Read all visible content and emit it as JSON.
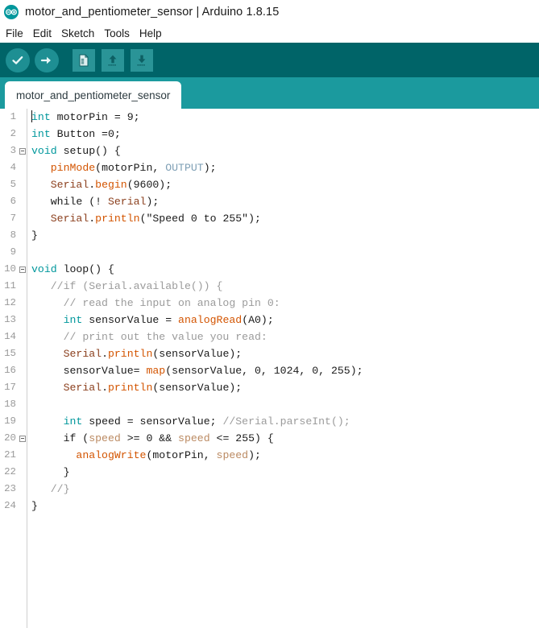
{
  "window": {
    "title": "motor_and_pentiometer_sensor | Arduino 1.8.15",
    "logo_icon": "arduino-infinity-logo"
  },
  "menubar": {
    "items": [
      {
        "label": "File"
      },
      {
        "label": "Edit"
      },
      {
        "label": "Sketch"
      },
      {
        "label": "Tools"
      },
      {
        "label": "Help"
      }
    ]
  },
  "toolbar": {
    "background": "#006468",
    "buttons": [
      {
        "name": "verify-button",
        "icon": "checkmark-icon",
        "shape": "round"
      },
      {
        "name": "upload-button",
        "icon": "arrow-right-icon",
        "shape": "round"
      },
      {
        "name": "new-button",
        "icon": "new-file-icon",
        "shape": "square"
      },
      {
        "name": "open-button",
        "icon": "arrow-up-icon",
        "shape": "square"
      },
      {
        "name": "save-button",
        "icon": "arrow-down-icon",
        "shape": "square"
      }
    ]
  },
  "tabs": {
    "background": "#1b9a9e",
    "active_tab": "motor_and_pentiometer_sensor"
  },
  "editor": {
    "accent_color": "#00979c",
    "lines": [
      {
        "n": "1",
        "fold": false,
        "tokens": [
          {
            "t": "caret",
            "c": "caret"
          },
          {
            "t": "int",
            "c": "kw"
          },
          {
            "t": " motorPin = 9;",
            "c": "plain"
          }
        ]
      },
      {
        "n": "2",
        "fold": false,
        "tokens": [
          {
            "t": "int",
            "c": "kw"
          },
          {
            "t": " Button =0;",
            "c": "plain"
          }
        ]
      },
      {
        "n": "3",
        "fold": true,
        "tokens": [
          {
            "t": "void",
            "c": "kw"
          },
          {
            "t": " setup() {",
            "c": "plain"
          }
        ]
      },
      {
        "n": "4",
        "fold": false,
        "tokens": [
          {
            "t": "   ",
            "c": "plain"
          },
          {
            "t": "pinMode",
            "c": "fn"
          },
          {
            "t": "(motorPin, ",
            "c": "plain"
          },
          {
            "t": "OUTPUT",
            "c": "cnst"
          },
          {
            "t": ");",
            "c": "plain"
          }
        ]
      },
      {
        "n": "5",
        "fold": false,
        "tokens": [
          {
            "t": "   ",
            "c": "plain"
          },
          {
            "t": "Serial",
            "c": "lib"
          },
          {
            "t": ".",
            "c": "plain"
          },
          {
            "t": "begin",
            "c": "fn"
          },
          {
            "t": "(9600);",
            "c": "plain"
          }
        ]
      },
      {
        "n": "6",
        "fold": false,
        "tokens": [
          {
            "t": "   while (! ",
            "c": "plain"
          },
          {
            "t": "Serial",
            "c": "lib"
          },
          {
            "t": ");",
            "c": "plain"
          }
        ]
      },
      {
        "n": "7",
        "fold": false,
        "tokens": [
          {
            "t": "   ",
            "c": "plain"
          },
          {
            "t": "Serial",
            "c": "lib"
          },
          {
            "t": ".",
            "c": "plain"
          },
          {
            "t": "println",
            "c": "fn"
          },
          {
            "t": "(\"Speed 0 to 255\");",
            "c": "plain"
          }
        ]
      },
      {
        "n": "8",
        "fold": false,
        "tokens": [
          {
            "t": "}",
            "c": "plain"
          }
        ]
      },
      {
        "n": "9",
        "fold": false,
        "tokens": [
          {
            "t": "",
            "c": "plain"
          }
        ]
      },
      {
        "n": "10",
        "fold": true,
        "tokens": [
          {
            "t": "void",
            "c": "kw"
          },
          {
            "t": " loop() {",
            "c": "plain"
          }
        ]
      },
      {
        "n": "11",
        "fold": false,
        "tokens": [
          {
            "t": "   ",
            "c": "plain"
          },
          {
            "t": "//if (Serial.available()) {",
            "c": "cmt"
          }
        ]
      },
      {
        "n": "12",
        "fold": false,
        "tokens": [
          {
            "t": "     ",
            "c": "plain"
          },
          {
            "t": "// read the input on analog pin 0:",
            "c": "cmt"
          }
        ]
      },
      {
        "n": "13",
        "fold": false,
        "tokens": [
          {
            "t": "     ",
            "c": "plain"
          },
          {
            "t": "int",
            "c": "kw"
          },
          {
            "t": " sensorValue = ",
            "c": "plain"
          },
          {
            "t": "analogRead",
            "c": "fn"
          },
          {
            "t": "(A0);",
            "c": "plain"
          }
        ]
      },
      {
        "n": "14",
        "fold": false,
        "tokens": [
          {
            "t": "     ",
            "c": "plain"
          },
          {
            "t": "// print out the value you read:",
            "c": "cmt"
          }
        ]
      },
      {
        "n": "15",
        "fold": false,
        "tokens": [
          {
            "t": "     ",
            "c": "plain"
          },
          {
            "t": "Serial",
            "c": "lib"
          },
          {
            "t": ".",
            "c": "plain"
          },
          {
            "t": "println",
            "c": "fn"
          },
          {
            "t": "(sensorValue);",
            "c": "plain"
          }
        ]
      },
      {
        "n": "16",
        "fold": false,
        "tokens": [
          {
            "t": "     sensorValue= ",
            "c": "plain"
          },
          {
            "t": "map",
            "c": "fn"
          },
          {
            "t": "(sensorValue, 0, 1024, 0, 255);",
            "c": "plain"
          }
        ]
      },
      {
        "n": "17",
        "fold": false,
        "tokens": [
          {
            "t": "     ",
            "c": "plain"
          },
          {
            "t": "Serial",
            "c": "lib"
          },
          {
            "t": ".",
            "c": "plain"
          },
          {
            "t": "println",
            "c": "fn"
          },
          {
            "t": "(sensorValue);",
            "c": "plain"
          }
        ]
      },
      {
        "n": "18",
        "fold": false,
        "tokens": [
          {
            "t": "",
            "c": "plain"
          }
        ]
      },
      {
        "n": "19",
        "fold": false,
        "tokens": [
          {
            "t": "     ",
            "c": "plain"
          },
          {
            "t": "int",
            "c": "kw"
          },
          {
            "t": " speed = sensorValue; ",
            "c": "plain"
          },
          {
            "t": "//Serial.parseInt();",
            "c": "cmt"
          }
        ]
      },
      {
        "n": "20",
        "fold": true,
        "tokens": [
          {
            "t": "     if (",
            "c": "plain"
          },
          {
            "t": "speed",
            "c": "var"
          },
          {
            "t": " >= 0 && ",
            "c": "plain"
          },
          {
            "t": "speed",
            "c": "var"
          },
          {
            "t": " <= 255) {",
            "c": "plain"
          }
        ]
      },
      {
        "n": "21",
        "fold": false,
        "tokens": [
          {
            "t": "       ",
            "c": "plain"
          },
          {
            "t": "analogWrite",
            "c": "fn"
          },
          {
            "t": "(motorPin, ",
            "c": "plain"
          },
          {
            "t": "speed",
            "c": "var"
          },
          {
            "t": ");",
            "c": "plain"
          }
        ]
      },
      {
        "n": "22",
        "fold": false,
        "tokens": [
          {
            "t": "     }",
            "c": "plain"
          }
        ]
      },
      {
        "n": "23",
        "fold": false,
        "tokens": [
          {
            "t": "   ",
            "c": "plain"
          },
          {
            "t": "//}",
            "c": "cmt"
          }
        ]
      },
      {
        "n": "24",
        "fold": false,
        "tokens": [
          {
            "t": "}",
            "c": "plain"
          }
        ]
      }
    ]
  }
}
